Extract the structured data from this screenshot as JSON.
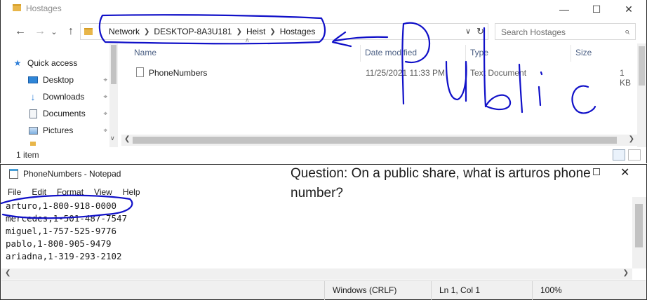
{
  "explorer": {
    "title": "Hostages",
    "window_controls": {
      "minimize": "—",
      "maximize": "☐",
      "close": "✕"
    },
    "nav": {
      "back": "←",
      "forward": "→",
      "recent": "⌄",
      "up": "↑"
    },
    "breadcrumb": [
      "Network",
      "DESKTOP-8A3U181",
      "Heist",
      "Hostages"
    ],
    "search_placeholder": "Search Hostages",
    "sidebar": {
      "items": [
        {
          "label": "Quick access",
          "icon": "star-icon",
          "pinned": false
        },
        {
          "label": "Desktop",
          "icon": "desktop-icon",
          "pinned": true
        },
        {
          "label": "Downloads",
          "icon": "download-icon",
          "pinned": true
        },
        {
          "label": "Documents",
          "icon": "documents-icon",
          "pinned": true
        },
        {
          "label": "Pictures",
          "icon": "pictures-icon",
          "pinned": true
        }
      ]
    },
    "columns": {
      "name": "Name",
      "date": "Date modified",
      "type": "Type",
      "size": "Size"
    },
    "files": [
      {
        "name": "PhoneNumbers",
        "date": "11/25/2021 11:33 PM",
        "type": "Text Document",
        "size": "1 KB"
      }
    ],
    "status": "1 item"
  },
  "notepad": {
    "title": "PhoneNumbers - Notepad",
    "menu": [
      "File",
      "Edit",
      "Format",
      "View",
      "Help"
    ],
    "lines": [
      "arturo,1-800-918-0000",
      "mercedes,1-501-487-7547",
      "miguel,1-757-525-9776",
      "pablo,1-800-905-9479",
      "ariadna,1-319-293-2102"
    ],
    "status": {
      "line_ending": "Windows (CRLF)",
      "position": "Ln 1, Col 1",
      "zoom": "100%"
    },
    "close": "✕"
  },
  "question": "Question: On a public share, what is arturos phone number?",
  "annotation": {
    "handwritten_text": "Public",
    "color": "#1010c8"
  }
}
